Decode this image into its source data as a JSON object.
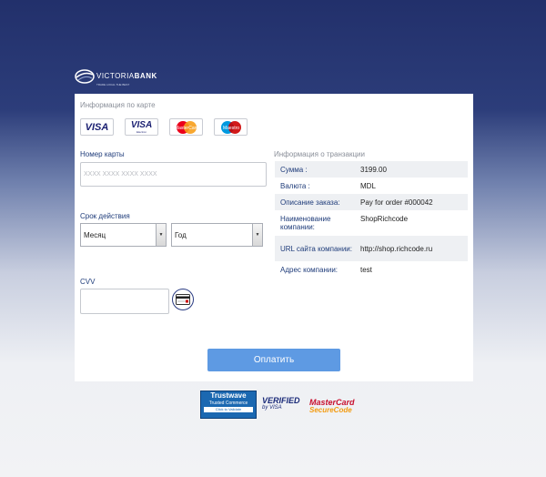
{
  "logo": {
    "brand_prefix": "VICTORIA",
    "brand_suffix": "BANK",
    "tagline": "TRADE LOCAL THE BEST"
  },
  "card_info": {
    "title": "Информация по карте",
    "brands": [
      "VISA",
      "VISA Electron",
      "MasterCard",
      "Maestro"
    ]
  },
  "form": {
    "card_number_label": "Номер карты",
    "card_number_placeholder": "XXXX XXXX XXXX XXXX",
    "expiry_label": "Срок действия",
    "month_selected": "Месяц",
    "year_selected": "Год",
    "cvv_label": "CVV",
    "pay_button": "Оплатить"
  },
  "transaction": {
    "title": "Информация о транзакции",
    "rows": [
      {
        "key": "Сумма :",
        "value": "3199.00"
      },
      {
        "key": "Валюта :",
        "value": "MDL"
      },
      {
        "key": "Описание заказа:",
        "value": "Pay for order #000042"
      },
      {
        "key": "Наименование компании:",
        "value": "ShopRichcode"
      },
      {
        "key": "URL сайта компании:",
        "value": "http://shop.richcode.ru"
      },
      {
        "key": "Адрес компании:",
        "value": "test"
      }
    ]
  },
  "badges": {
    "trustwave_title": "Trustwave",
    "trustwave_sub": "Trusted Commerce",
    "trustwave_link": "Click to Validate",
    "vbv_line1": "VERIFIED",
    "vbv_line2": "by VISA",
    "mc_line1": "MasterCard",
    "mc_line2": "SecureCode"
  },
  "colors": {
    "accent_button": "#5e9ae3",
    "label_blue": "#1f3c7a",
    "header_navy": "#22306b"
  }
}
